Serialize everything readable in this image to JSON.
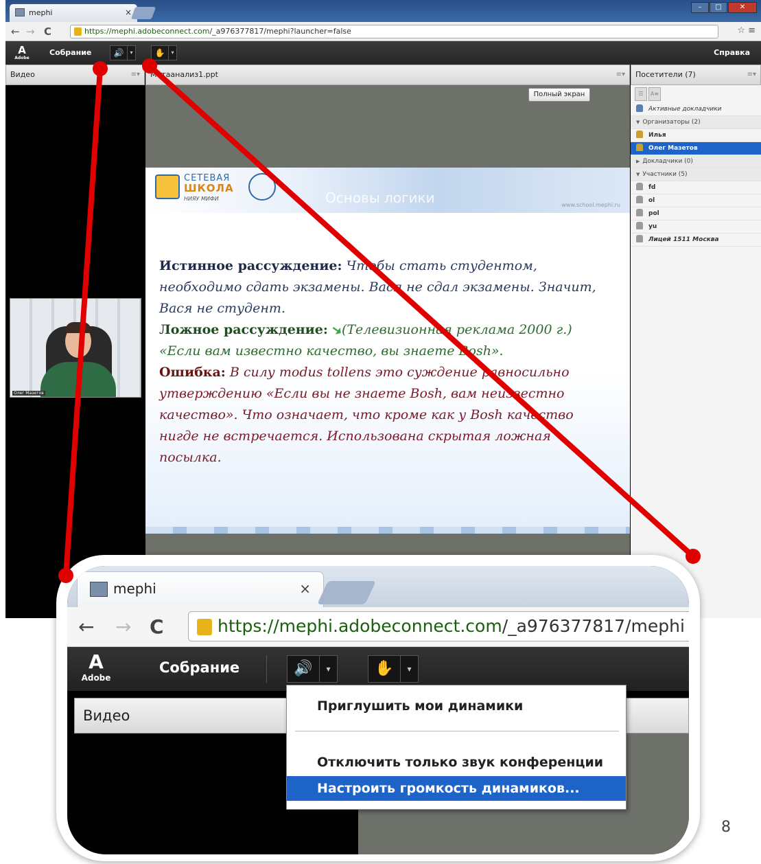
{
  "browser": {
    "tab_title": "mephi",
    "tab_close": "×",
    "url_host": "https://mephi.adobeconnect.com",
    "url_path": "/_a976377817/mephi?launcher=false"
  },
  "app": {
    "logo": "Adobe",
    "meeting_menu": "Собрание",
    "help_menu": "Справка",
    "speaker_glyph": "🔊",
    "presenter_glyph": "✋",
    "dropdown_glyph": "▾"
  },
  "panels": {
    "video_title": "Видео",
    "share_title": "Метаанализ1.ppt",
    "fullscreen_button": "Полный экран",
    "attendees_title": "Посетители (7)",
    "options_glyph": "≡▾"
  },
  "slide": {
    "school_top": "СЕТЕВАЯ",
    "school_mid": "ШКОЛА",
    "school_sub": "НИЯУ МИФИ",
    "title": "Основы логики",
    "url": "www.school.mephi.ru",
    "p1_label": "Истинное рассуждение:",
    "p1_text": "Чтобы стать студентом, необходимо сдать экзамены. Вася не сдал экзамены. Значит, Вася не студент.",
    "p2_label": "Ложное рассуждение:",
    "p2_text": "(Телевизионная реклама 2000 г.) «Если вам известно качество, вы знаете Bosh».",
    "p3_label": "Ошибка:",
    "p3_text": "В силу modus tollens это суждение равносильно утверждению «Если вы не знаете Bosh, вам неизвестно качество». Что означает, что кроме как у Bosh качество нигде не встречается. Использована скрытая ложная посылка."
  },
  "attendees": {
    "active_speakers": "Активные докладчики",
    "hosts_group": "Организаторы (2)",
    "hosts": [
      "Илья",
      "Олег Мазетов"
    ],
    "presenters_group": "Докладчики (0)",
    "participants_group": "Участники (5)",
    "participants": [
      "fd",
      "ol",
      "pol",
      "yu",
      "Лицей 1511 Москва"
    ]
  },
  "camera": {
    "caption": "Олег Мазетов"
  },
  "inset": {
    "tab_title": "mephi",
    "url_host": "https://mephi.adobeconnect.com",
    "url_path": "/_a976377817/mephi",
    "meeting_menu": "Собрание",
    "video_title": "Видео",
    "menu_items": [
      "Приглушить мои динамики",
      "Отключить только звук конференции",
      "Настроить громкость динамиков..."
    ]
  },
  "page_number": "8",
  "colors": {
    "callout": "#e00000",
    "selection": "#1e64c8",
    "speaker_on": "#3fd44a"
  }
}
